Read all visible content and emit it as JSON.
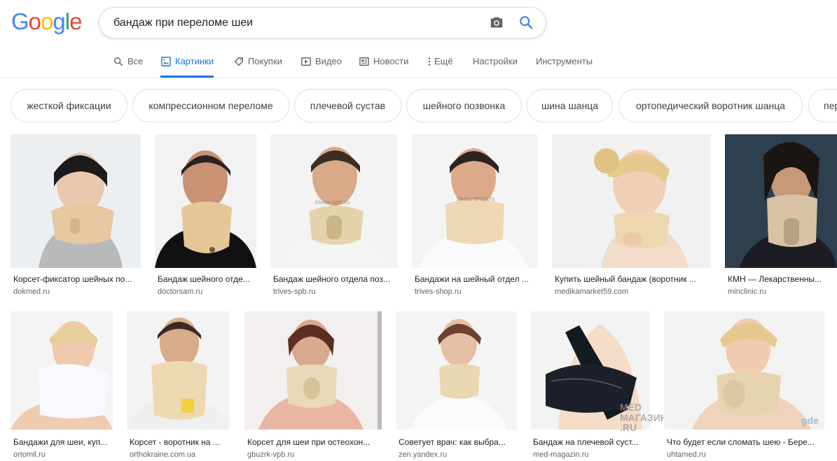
{
  "logo": {
    "letters": [
      "G",
      "o",
      "o",
      "g",
      "l",
      "e"
    ],
    "colors": [
      "#4285f4",
      "#ea4335",
      "#fbbc05",
      "#4285f4",
      "#34a853",
      "#ea4335"
    ]
  },
  "search": {
    "query": "бандаж при переломе шеи",
    "camera_icon": "camera-icon",
    "search_icon": "magnifier-icon"
  },
  "tabs": [
    {
      "label": "Все",
      "icon": "search-icon"
    },
    {
      "label": "Картинки",
      "icon": "image-icon",
      "active": true
    },
    {
      "label": "Покупки",
      "icon": "tag-icon"
    },
    {
      "label": "Видео",
      "icon": "play-icon"
    },
    {
      "label": "Новости",
      "icon": "news-icon"
    },
    {
      "label": "Ещё",
      "icon": "more-vert-icon"
    },
    {
      "label": "Настройки"
    },
    {
      "label": "Инструменты"
    }
  ],
  "chips": [
    "жесткой фиксации",
    "компрессионном переломе",
    "плечевой сустав",
    "шейного позвонка",
    "шина шанца",
    "ортопедический воротник шанца",
    "пер"
  ],
  "results_row1": [
    {
      "title": "Корсет-фиксатор шейных по...",
      "source": "dokmed.ru"
    },
    {
      "title": "Бандаж шейного отде...",
      "source": "doctorsam.ru"
    },
    {
      "title": "Бандаж шейного отдела поз...",
      "source": "trives-spb.ru",
      "watermark": "trives-spb.ru"
    },
    {
      "title": "Бандажи на шейный отдел ...",
      "source": "trives-shop.ru",
      "watermark": "trives-shop.ru"
    },
    {
      "title": "Купить шейный бандаж (воротник ...",
      "source": "medikamarket59.com"
    },
    {
      "title": "КМН — Лекарственны...",
      "source": "minclinic.ru"
    }
  ],
  "results_row2": [
    {
      "title": "Бандажи для шеи, куп...",
      "source": "ortomil.ru"
    },
    {
      "title": "Корсет - воротник на ...",
      "source": "orthokraine.com.ua"
    },
    {
      "title": "Корсет для шеи при остеохон...",
      "source": "gbuzrk-vpb.ru"
    },
    {
      "title": "Советует врач: как выбра...",
      "source": "zen.yandex.ru"
    },
    {
      "title": "Бандаж на плечевой суст...",
      "source": "med-magazin.ru",
      "watermark": "MED МАГАЗИН .RU"
    },
    {
      "title": "Что будет если сломать шею - Бере...",
      "source": "uhtamed.ru",
      "watermark": "gde"
    }
  ],
  "colors": {
    "accent": "#1a73e8",
    "text_secondary": "#5f6368",
    "border": "#dfe1e5"
  }
}
